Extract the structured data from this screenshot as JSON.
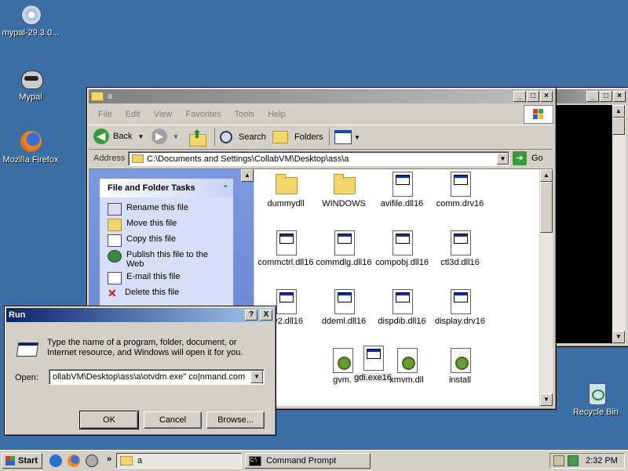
{
  "desktop": {
    "icons": [
      {
        "label": "mypal-29.3.0...",
        "icon": "installer-disc-icon"
      },
      {
        "label": "Mypal",
        "icon": "mypal-raccoon-icon"
      },
      {
        "label": "Mozilla Firefox",
        "icon": "firefox-icon"
      },
      {
        "label": "Recycle Bin",
        "icon": "recycle-bin-icon"
      }
    ]
  },
  "explorer": {
    "title": "a",
    "menu": [
      "File",
      "Edit",
      "View",
      "Favorites",
      "Tools",
      "Help"
    ],
    "toolbar": {
      "back": "Back",
      "search": "Search",
      "folders": "Folders"
    },
    "address_label": "Address",
    "address_value": "C:\\Documents and Settings\\CollabVM\\Desktop\\ass\\a",
    "go_label": "Go",
    "tasks": {
      "header": "File and Folder Tasks",
      "items": [
        {
          "label": "Rename this file",
          "icon": "rename-icon"
        },
        {
          "label": "Move this file",
          "icon": "move-icon"
        },
        {
          "label": "Copy this file",
          "icon": "copy-icon"
        },
        {
          "label": "Publish this file to the Web",
          "icon": "publish-web-icon"
        },
        {
          "label": "E-mail this file",
          "icon": "email-icon"
        },
        {
          "label": "Delete this file",
          "icon": "delete-icon"
        }
      ]
    },
    "files": [
      {
        "name": "dummydll",
        "type": "folder"
      },
      {
        "name": "WINDOWS",
        "type": "folder"
      },
      {
        "name": "avifile.dll16",
        "type": "doc"
      },
      {
        "name": "comm.drv16",
        "type": "doc"
      },
      {
        "name": "commctrl.dll16",
        "type": "doc"
      },
      {
        "name": "commdlg.dll16",
        "type": "doc"
      },
      {
        "name": "compobj.dll16",
        "type": "doc"
      },
      {
        "name": "ctl3d.dll16",
        "type": "doc"
      },
      {
        "name": "dv2.dll16",
        "type": "doc"
      },
      {
        "name": "ddeml.dll16",
        "type": "doc"
      },
      {
        "name": "dispdib.dll16",
        "type": "doc"
      },
      {
        "name": "display.drv16",
        "type": "doc"
      },
      {
        "name": "gvm.",
        "type": "gear"
      },
      {
        "name": "gdi.exe16",
        "type": "doc"
      },
      {
        "name": "xmvm.dll",
        "type": "gear"
      },
      {
        "name": "install",
        "type": "setup"
      }
    ]
  },
  "run_dialog": {
    "title": "Run",
    "help_btn": "?",
    "close_btn": "X",
    "description": "Type the name of a program, folder, document, or Internet resource, and Windows will open it for you.",
    "open_label": "Open:",
    "open_value": "ollabVM\\Desktop\\ass\\a\\otvdm.exe\" co|nmand.com",
    "ok": "OK",
    "cancel": "Cancel",
    "browse": "Browse..."
  },
  "taskbar": {
    "start": "Start",
    "quicklaunch_arrow": "»",
    "tasks": [
      {
        "label": "a",
        "icon": "folder-icon"
      },
      {
        "label": "Command Prompt",
        "icon": "cmd-icon"
      }
    ],
    "clock": "2:32 PM"
  },
  "colors": {
    "desktop": "#3a6ea5",
    "title_active": "#0a246a",
    "title_inactive": "#808080"
  }
}
